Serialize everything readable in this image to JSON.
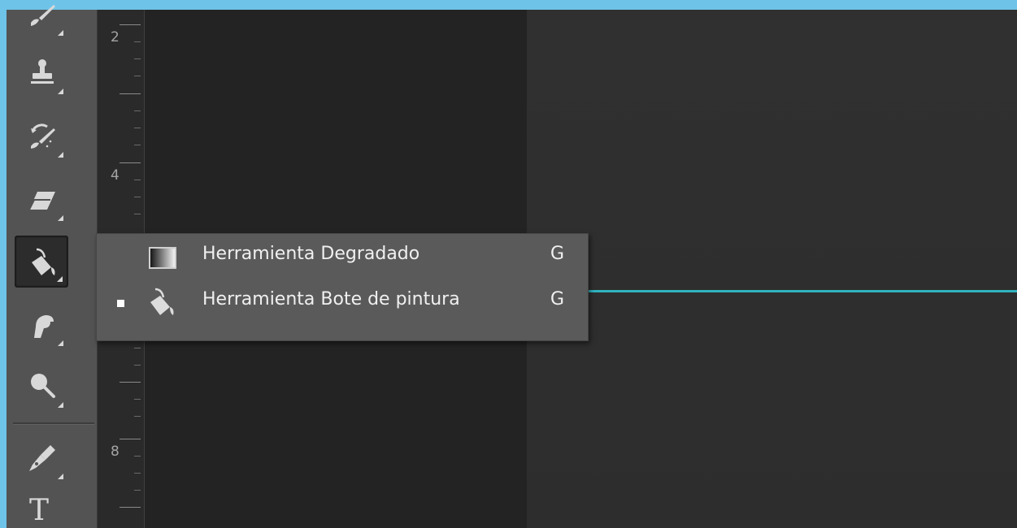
{
  "toolbar": {
    "tools": [
      {
        "id": "brush",
        "icon": "brush-icon"
      },
      {
        "id": "clone-stamp",
        "icon": "clone-stamp-icon"
      },
      {
        "id": "history-brush",
        "icon": "history-brush-icon"
      },
      {
        "id": "eraser",
        "icon": "eraser-icon"
      },
      {
        "id": "paint-bucket",
        "icon": "paint-bucket-icon",
        "active": true
      },
      {
        "id": "smudge",
        "icon": "smudge-icon"
      },
      {
        "id": "dodge",
        "icon": "dodge-icon"
      },
      {
        "id": "pen",
        "icon": "pen-icon"
      },
      {
        "id": "type",
        "icon": "type-icon",
        "glyph": "T"
      }
    ]
  },
  "ruler": {
    "labels": [
      "2",
      "4",
      "8"
    ]
  },
  "flyout": {
    "items": [
      {
        "label": "Herramienta Degradado",
        "shortcut": "G",
        "icon": "gradient-tool-icon",
        "selected": false
      },
      {
        "label": "Herramienta Bote de pintura",
        "shortcut": "G",
        "icon": "paint-bucket-icon",
        "selected": true
      }
    ]
  },
  "colors": {
    "frame": "#6ec3e8",
    "toolbar": "#535353",
    "pasteboard": "#232323",
    "canvas": "#2e2e2e",
    "guide": "#2fb3bf",
    "menu": "#5a5a5a"
  }
}
